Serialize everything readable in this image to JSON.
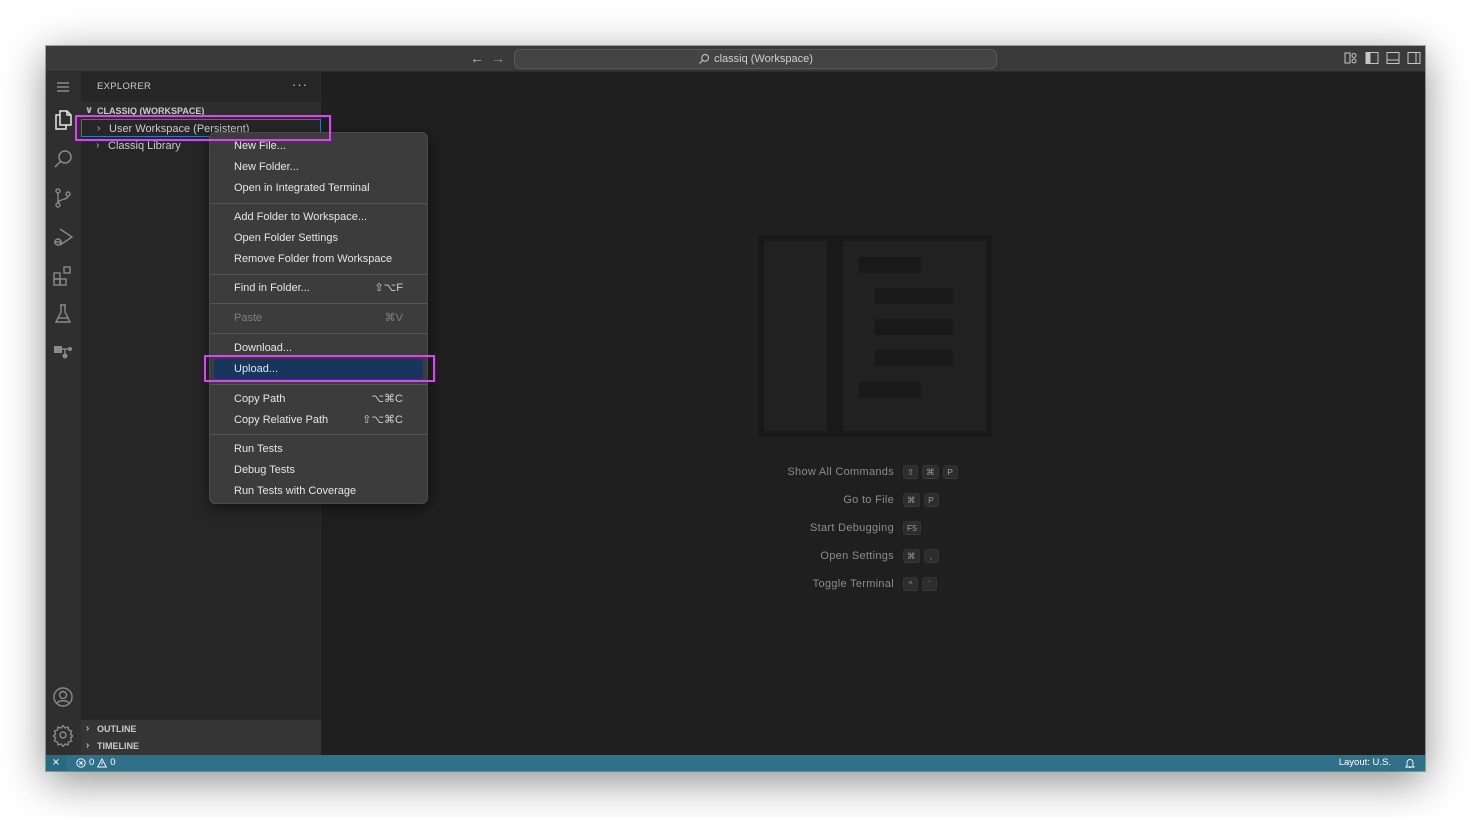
{
  "titlebar": {
    "search_text": "classiq (Workspace)",
    "back_icon": "arrow-left",
    "forward_icon": "arrow-right",
    "layout_icons": [
      "customize-layout-icon",
      "toggle-primary-sidebar-icon",
      "toggle-panel-icon",
      "toggle-secondary-sidebar-icon"
    ]
  },
  "activitybar": {
    "items": [
      {
        "name": "menu",
        "icon": "hamburger-menu"
      },
      {
        "name": "explorer",
        "icon": "files",
        "active": true
      },
      {
        "name": "search",
        "icon": "search"
      },
      {
        "name": "source-control",
        "icon": "git-branch"
      },
      {
        "name": "run-and-debug",
        "icon": "run-debug"
      },
      {
        "name": "extensions",
        "icon": "extensions"
      },
      {
        "name": "testing",
        "icon": "beaker"
      },
      {
        "name": "remote-explorer",
        "icon": "remote-tree"
      }
    ],
    "bottom": [
      {
        "name": "accounts",
        "icon": "account"
      },
      {
        "name": "manage",
        "icon": "gear"
      }
    ]
  },
  "sidebar": {
    "title": "EXPLORER",
    "more_label": "···",
    "workspace_header": "CLASSIQ (WORKSPACE)",
    "tree": [
      {
        "label": "User Workspace (Persistent)",
        "selected": true
      },
      {
        "label": "Classiq Library",
        "selected": false
      }
    ],
    "sections": [
      "OUTLINE",
      "TIMELINE"
    ]
  },
  "context_menu": {
    "groups": [
      [
        {
          "label": "New File...",
          "shortcut": ""
        },
        {
          "label": "New Folder...",
          "shortcut": ""
        },
        {
          "label": "Open in Integrated Terminal",
          "shortcut": ""
        }
      ],
      [
        {
          "label": "Add Folder to Workspace...",
          "shortcut": ""
        },
        {
          "label": "Open Folder Settings",
          "shortcut": ""
        },
        {
          "label": "Remove Folder from Workspace",
          "shortcut": ""
        }
      ],
      [
        {
          "label": "Find in Folder...",
          "shortcut": "⇧⌥F"
        }
      ],
      [
        {
          "label": "Paste",
          "shortcut": "⌘V",
          "disabled": true
        }
      ],
      [
        {
          "label": "Download...",
          "shortcut": ""
        },
        {
          "label": "Upload...",
          "shortcut": "",
          "active": true
        }
      ],
      [
        {
          "label": "Copy Path",
          "shortcut": "⌥⌘C"
        },
        {
          "label": "Copy Relative Path",
          "shortcut": "⇧⌥⌘C"
        }
      ],
      [
        {
          "label": "Run Tests",
          "shortcut": ""
        },
        {
          "label": "Debug Tests",
          "shortcut": ""
        },
        {
          "label": "Run Tests with Coverage",
          "shortcut": ""
        }
      ]
    ]
  },
  "editor": {
    "shortcuts": [
      {
        "label": "Show All Commands",
        "keys": [
          "⇧",
          "⌘",
          "P"
        ]
      },
      {
        "label": "Go to File",
        "keys": [
          "⌘",
          "P"
        ]
      },
      {
        "label": "Start Debugging",
        "keys": [
          "F5"
        ]
      },
      {
        "label": "Open Settings",
        "keys": [
          "⌘",
          ","
        ]
      },
      {
        "label": "Toggle Terminal",
        "keys": [
          "^",
          "`"
        ]
      }
    ]
  },
  "statusbar": {
    "remote_icon": "remote",
    "errors": "0",
    "warnings": "0",
    "layout": "Layout: U.S.",
    "bell_icon": "bell"
  },
  "colors": {
    "accent_highlight": "#e040fb",
    "statusbar": "#2e7189",
    "menu_active": "#17365d",
    "selection_border": "#2b79c9"
  }
}
